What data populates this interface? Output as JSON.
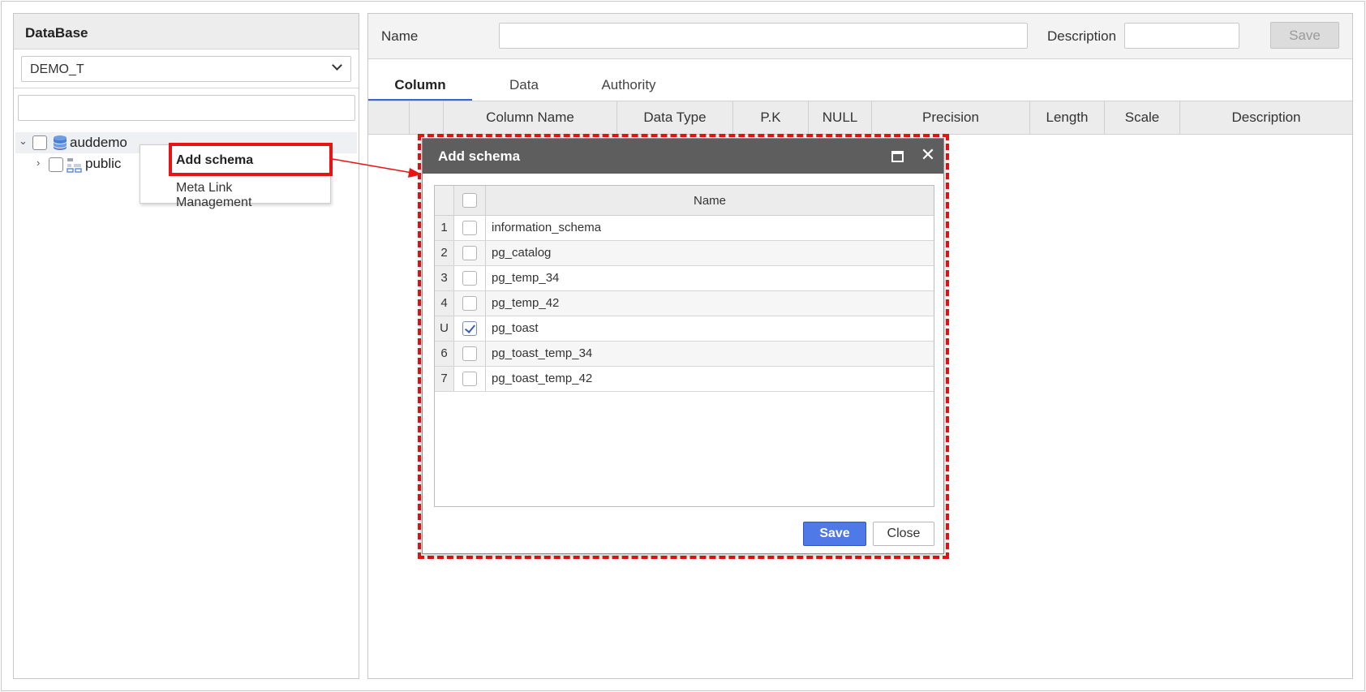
{
  "sidebar": {
    "title": "DataBase",
    "db_select_value": "DEMO_T",
    "tree": {
      "root_label": "auddemo",
      "child_label": "public"
    }
  },
  "context_menu": {
    "items": [
      "Add schema",
      "Meta Link Management"
    ]
  },
  "form": {
    "name_label": "Name",
    "description_label": "Description",
    "save_label": "Save"
  },
  "tabs": [
    "Column",
    "Data",
    "Authority"
  ],
  "grid": {
    "columns": [
      "Column Name",
      "Data Type",
      "P.K",
      "NULL",
      "Precision",
      "Length",
      "Scale",
      "Description"
    ]
  },
  "dialog": {
    "title": "Add schema",
    "column_header": "Name",
    "rows": [
      {
        "num": "1",
        "name": "information_schema",
        "checked": false
      },
      {
        "num": "2",
        "name": "pg_catalog",
        "checked": false
      },
      {
        "num": "3",
        "name": "pg_temp_34",
        "checked": false
      },
      {
        "num": "4",
        "name": "pg_temp_42",
        "checked": false
      },
      {
        "num": "U",
        "name": "pg_toast",
        "checked": true
      },
      {
        "num": "6",
        "name": "pg_toast_temp_34",
        "checked": false
      },
      {
        "num": "7",
        "name": "pg_toast_temp_42",
        "checked": false
      }
    ],
    "save_label": "Save",
    "close_label": "Close"
  },
  "colors": {
    "highlight": "#e81414",
    "primary_button": "#4f79e6",
    "title_bar": "#5e5e5e",
    "active_tab": "#3b68c9"
  }
}
